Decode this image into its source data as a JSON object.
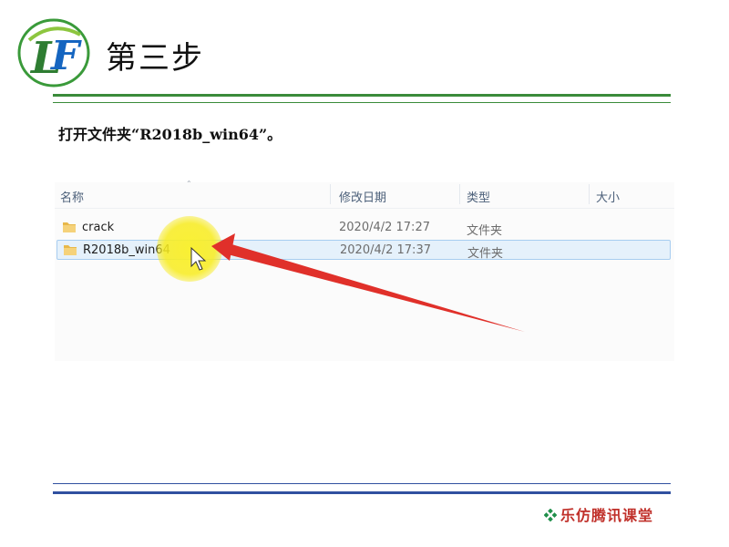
{
  "slide": {
    "title": "第三步",
    "instruction": "打开文件夹“R2018b_win64”。",
    "footer_brand": "乐仿腾讯课堂"
  },
  "logo": {
    "letters": "LF",
    "colors": {
      "ring": "#3a9a3a",
      "l": "#2e7d32",
      "f": "#1565c0"
    }
  },
  "explorer": {
    "columns": [
      {
        "label": "名称"
      },
      {
        "label": "修改日期"
      },
      {
        "label": "类型"
      },
      {
        "label": "大小"
      }
    ],
    "rows": [
      {
        "name": "crack",
        "date": "2020/4/2 17:27",
        "type": "文件夹",
        "selected": false
      },
      {
        "name": "R2018b_win64",
        "date": "2020/4/2 17:37",
        "type": "文件夹",
        "selected": true
      }
    ]
  },
  "colors": {
    "accent_green": "#3a8b3a",
    "accent_blue": "#3050a0",
    "arrow_red": "#e0302a",
    "highlight_yellow": "#f8ec1e",
    "selection_bg": "#e5f1fb"
  }
}
